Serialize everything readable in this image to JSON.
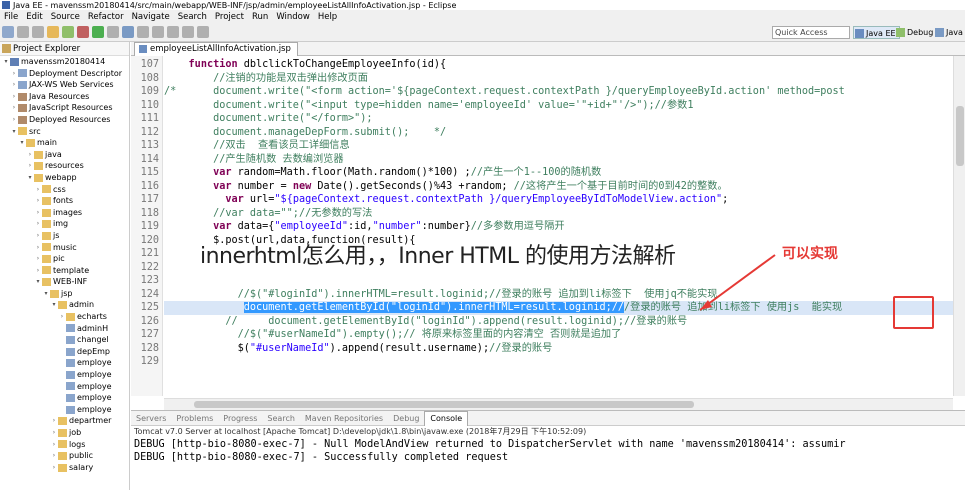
{
  "window": {
    "title": "Java EE - mavenssm20180414/src/main/webapp/WEB-INF/jsp/admin/employeeListAllInfoActivation.jsp - Eclipse"
  },
  "menu": [
    "File",
    "Edit",
    "Source",
    "Refactor",
    "Navigate",
    "Search",
    "Project",
    "Run",
    "Window",
    "Help"
  ],
  "toolbar": {
    "quick_access": "Quick Access",
    "perspectives": [
      "Java EE",
      "Debug",
      "Java"
    ]
  },
  "project_explorer": {
    "title": "Project Explorer",
    "items": [
      {
        "label": "mavenssm20180414",
        "indent": 0,
        "arrow": "▾",
        "icon": "proj"
      },
      {
        "label": "Deployment Descriptor",
        "indent": 1,
        "arrow": "›",
        "icon": "file"
      },
      {
        "label": "JAX-WS Web Services",
        "indent": 1,
        "arrow": "›",
        "icon": "file"
      },
      {
        "label": "Java Resources",
        "indent": 1,
        "arrow": "›",
        "icon": "lib"
      },
      {
        "label": "JavaScript Resources",
        "indent": 1,
        "arrow": "›",
        "icon": "lib"
      },
      {
        "label": "Deployed Resources",
        "indent": 1,
        "arrow": "›",
        "icon": "lib"
      },
      {
        "label": "src",
        "indent": 1,
        "arrow": "▾",
        "icon": "folder"
      },
      {
        "label": "main",
        "indent": 2,
        "arrow": "▾",
        "icon": "folder"
      },
      {
        "label": "java",
        "indent": 3,
        "arrow": "›",
        "icon": "folder"
      },
      {
        "label": "resources",
        "indent": 3,
        "arrow": "›",
        "icon": "folder"
      },
      {
        "label": "webapp",
        "indent": 3,
        "arrow": "▾",
        "icon": "folder"
      },
      {
        "label": "css",
        "indent": 4,
        "arrow": "›",
        "icon": "folder"
      },
      {
        "label": "fonts",
        "indent": 4,
        "arrow": "›",
        "icon": "folder"
      },
      {
        "label": "images",
        "indent": 4,
        "arrow": "›",
        "icon": "folder"
      },
      {
        "label": "img",
        "indent": 4,
        "arrow": "›",
        "icon": "folder"
      },
      {
        "label": "js",
        "indent": 4,
        "arrow": "›",
        "icon": "folder"
      },
      {
        "label": "music",
        "indent": 4,
        "arrow": "›",
        "icon": "folder"
      },
      {
        "label": "pic",
        "indent": 4,
        "arrow": "›",
        "icon": "folder"
      },
      {
        "label": "template",
        "indent": 4,
        "arrow": "›",
        "icon": "folder"
      },
      {
        "label": "WEB-INF",
        "indent": 4,
        "arrow": "▾",
        "icon": "folder"
      },
      {
        "label": "jsp",
        "indent": 5,
        "arrow": "▾",
        "icon": "folder"
      },
      {
        "label": "admin",
        "indent": 6,
        "arrow": "▾",
        "icon": "folder"
      },
      {
        "label": "echarts",
        "indent": 7,
        "arrow": "›",
        "icon": "folder"
      },
      {
        "label": "adminH",
        "indent": 7,
        "arrow": "",
        "icon": "file"
      },
      {
        "label": "changel",
        "indent": 7,
        "arrow": "",
        "icon": "file"
      },
      {
        "label": "depEmp",
        "indent": 7,
        "arrow": "",
        "icon": "file"
      },
      {
        "label": "employe",
        "indent": 7,
        "arrow": "",
        "icon": "file"
      },
      {
        "label": "employe",
        "indent": 7,
        "arrow": "",
        "icon": "file"
      },
      {
        "label": "employe",
        "indent": 7,
        "arrow": "",
        "icon": "file"
      },
      {
        "label": "employe",
        "indent": 7,
        "arrow": "",
        "icon": "file"
      },
      {
        "label": "employe",
        "indent": 7,
        "arrow": "",
        "icon": "file"
      },
      {
        "label": "departmer",
        "indent": 6,
        "arrow": "›",
        "icon": "folder"
      },
      {
        "label": "job",
        "indent": 6,
        "arrow": "›",
        "icon": "folder"
      },
      {
        "label": "logs",
        "indent": 6,
        "arrow": "›",
        "icon": "folder"
      },
      {
        "label": "public",
        "indent": 6,
        "arrow": "›",
        "icon": "folder"
      },
      {
        "label": "salary",
        "indent": 6,
        "arrow": "›",
        "icon": "folder"
      }
    ]
  },
  "editor": {
    "tab": "employeeListAllInfoActivation.jsp",
    "lines": [
      {
        "n": "107",
        "html": "    <span class=\"kw\">function</span> dblclickToChangeEmployeeInfo(id){"
      },
      {
        "n": "108",
        "html": "        <span class=\"cm\">//注销的功能是双击弹出修改页面</span>"
      },
      {
        "n": "109",
        "html": "<span class=\"cm\">/*      document.write(\"&lt;form action='${pageContext.request.contextPath }/queryEmployeeById.action' method=post</span>"
      },
      {
        "n": "110",
        "html": "<span class=\"cm\">        document.write(\"&lt;input type=hidden name='employeeId' value='\"+id+\"'/&gt;\");//参数1</span>"
      },
      {
        "n": "111",
        "html": "<span class=\"cm\">        document.write(\"&lt;/form&gt;\");</span>"
      },
      {
        "n": "112",
        "html": "<span class=\"cm\">        document.manageDepForm.submit();    */</span>"
      },
      {
        "n": "113",
        "html": "        <span class=\"cm\">//双击  查看该员工详细信息</span>"
      },
      {
        "n": "114",
        "html": "        <span class=\"cm\">//产生随机数 去数编浏览器</span>"
      },
      {
        "n": "115",
        "html": "        <span class=\"kw\">var</span> random=Math.floor(Math.random()*100) ;<span class=\"cm\">//产生一个1--100的随机数</span>"
      },
      {
        "n": "116",
        "html": "        <span class=\"kw\">var</span> number = <span class=\"kw\">new</span> Date().getSeconds()%43 +random; <span class=\"cm\">//这将产生一个基于目前时间的0到42的整数。</span>"
      },
      {
        "n": "117",
        "html": "          <span class=\"kw\">var</span> url=<span class=\"st\">\"${pageContext.request.contextPath }/queryEmployeeByIdToModelView.action\"</span>;"
      },
      {
        "n": "118",
        "html": "        <span class=\"cm\">//var data=\"\";//无参数的写法</span>"
      },
      {
        "n": "119",
        "html": "        <span class=\"kw\">var</span> data={<span class=\"st\">\"employeeId\"</span>:id,<span class=\"st\">\"number\"</span>:number}<span class=\"cm\">//多参数用逗号隔开</span>"
      },
      {
        "n": "120",
        "html": "        $.post(url,data,function(result){"
      },
      {
        "n": "121",
        "html": ""
      },
      {
        "n": "122",
        "html": ""
      },
      {
        "n": "123",
        "html": ""
      },
      {
        "n": "124",
        "html": "            <span class=\"cm\">//$(\"#loginId\").innerHTML=result.loginid;//登录的账号 追加到li标签下  使用jq不能实现</span>"
      },
      {
        "n": "125",
        "html": "             <span class=\"sel\">document.getElementById(\"loginId\").innerHTML=result.loginid;//</span><span class=\"cm\">/登录的账号 追加到li标签下 使用js  能实现</span>",
        "hl": true
      },
      {
        "n": "126",
        "html": "          <span class=\"cm\">//     document.getElementById(\"loginId\").append(result.loginid);//登录的账号</span>"
      },
      {
        "n": "127",
        "html": "            <span class=\"cm\">//$(\"#userNameId\").empty();// 将原来标签里面的内容清空 否则就是追加了</span>"
      },
      {
        "n": "128",
        "html": "            $(<span class=\"st\">\"#userNameId\"</span>).append(result.username);<span class=\"cm\">//登录的账号</span>"
      },
      {
        "n": "129",
        "html": ""
      }
    ]
  },
  "overlay": {
    "title": "innerhtml怎么用，，Inner HTML 的使用方法解析",
    "annotation": "可以实现"
  },
  "console": {
    "tabs": [
      "Servers",
      "Problems",
      "Progress",
      "Search",
      "Maven Repositories",
      "Debug",
      "Console"
    ],
    "active_tab": "Console",
    "info": "Tomcat v7.0 Server at localhost [Apache Tomcat] D:\\develop\\jdk\\1.8\\bin\\javaw.exe (2018年7月29日 下午10:52:09)",
    "lines": [
      "DEBUG [http-bio-8080-exec-7] - Null ModelAndView returned to DispatcherServlet with name 'mavenssm20180414': assumir",
      "DEBUG [http-bio-8080-exec-7] - Successfully completed request"
    ]
  }
}
